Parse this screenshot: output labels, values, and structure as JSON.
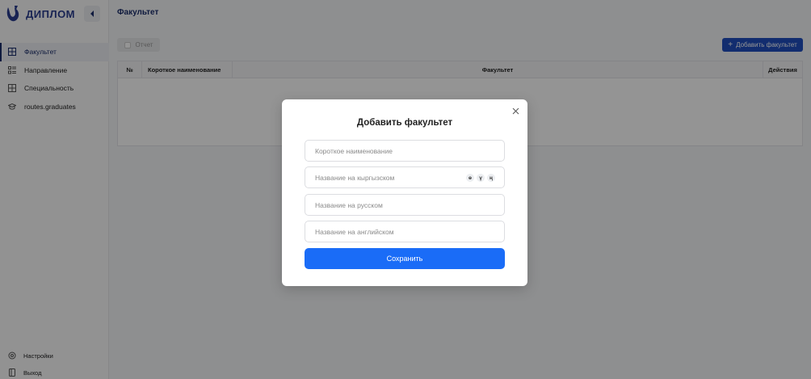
{
  "app": {
    "logo_text": "ДИПЛОМ"
  },
  "sidebar": {
    "items": [
      {
        "label": "Факультет",
        "icon": "grid-icon",
        "active": true
      },
      {
        "label": "Направление",
        "icon": "list-icon",
        "active": false
      },
      {
        "label": "Специальность",
        "icon": "grid-icon",
        "active": false
      },
      {
        "label": "routes.graduates",
        "icon": "graduation-cap-icon",
        "active": false
      }
    ],
    "bottom": {
      "settings_label": "Настройки",
      "logout_label": "Выход"
    }
  },
  "page": {
    "title": "Факультет",
    "report_label": "Отчет",
    "add_label": "Добавить факультет"
  },
  "table": {
    "columns": [
      "№",
      "Короткое наименование",
      "Факультет",
      "Действия"
    ],
    "rows": []
  },
  "modal": {
    "title": "Добавить факультет",
    "fields": {
      "short_name": {
        "placeholder": "Короткое наименование",
        "value": ""
      },
      "name_kg": {
        "placeholder": "Название на кыргызском",
        "value": ""
      },
      "name_ru": {
        "placeholder": "Название на русском",
        "value": ""
      },
      "name_en": {
        "placeholder": "Название на английском",
        "value": ""
      }
    },
    "kg_chars": [
      "ө",
      "ү",
      "ң"
    ],
    "save_label": "Сохранить"
  },
  "colors": {
    "brand": "#1b2e6b",
    "primary_button": "#1a6cf7",
    "add_button": "#1f4fbf"
  }
}
